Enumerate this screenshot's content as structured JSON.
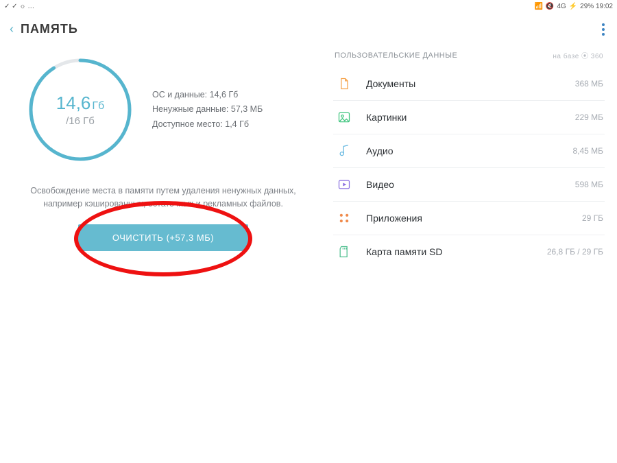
{
  "status": {
    "left_glyphs": "✓ ✓ ☼ …",
    "right_text": "29%  19:02",
    "signal": "4G"
  },
  "header": {
    "title": "ПАМЯТЬ"
  },
  "gauge": {
    "used_value": "14,6",
    "used_unit": "Гб",
    "total": "/16 Гб",
    "percent": 91
  },
  "stats": {
    "line1": "ОС и данные: 14,6 Гб",
    "line2": "Ненужные данные: 57,3 МБ",
    "line3": "Доступное место: 1,4 Гб"
  },
  "description": "Освобождение места в памяти путем удаления ненужных данных, например кэшированных, остаточных и рекламных файлов.",
  "clean_button": "ОЧИСТИТЬ (+57,3 МБ)",
  "section": {
    "title": "ПОЛЬЗОВАТЕЛЬСКИЕ ДАННЫЕ",
    "brand": "на базе ⦿ 360"
  },
  "items": [
    {
      "icon": "document",
      "label": "Документы",
      "value": "368 МБ",
      "color": "#f5a24a"
    },
    {
      "icon": "image",
      "label": "Картинки",
      "value": "229 МБ",
      "color": "#3cc47c"
    },
    {
      "icon": "audio",
      "label": "Аудио",
      "value": "8,45 МБ",
      "color": "#63b7e0"
    },
    {
      "icon": "video",
      "label": "Видео",
      "value": "598 МБ",
      "color": "#8a6fe0"
    },
    {
      "icon": "apps",
      "label": "Приложения",
      "value": "29 ГБ",
      "color": "#f08a4b"
    },
    {
      "icon": "sdcard",
      "label": "Карта памяти SD",
      "value": "26,8 ГБ / 29 ГБ",
      "color": "#4fbf8f"
    }
  ]
}
